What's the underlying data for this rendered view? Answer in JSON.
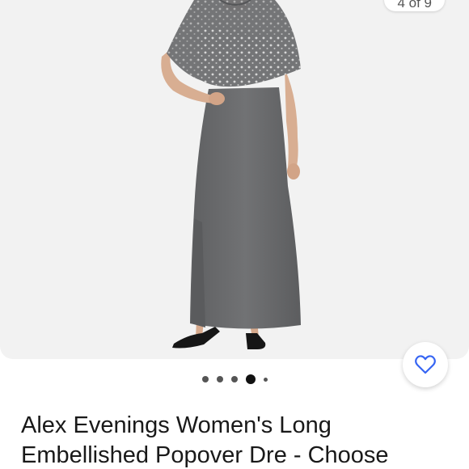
{
  "gallery": {
    "counter_text": "4 of 9",
    "image_alt": "Gray long gown with embellished sheer popover cape",
    "dots": [
      "inactive",
      "inactive",
      "inactive",
      "active",
      "small"
    ],
    "active_index": 3
  },
  "watch": {
    "icon": "heart-icon",
    "color": "#3665f3"
  },
  "product": {
    "title": "Alex Evenings Women's Long Embellished Popover Dre - Choose"
  },
  "colors": {
    "gallery_background": "#f2f2f2",
    "dress": "#6b6c6e",
    "accent": "#3665f3"
  }
}
